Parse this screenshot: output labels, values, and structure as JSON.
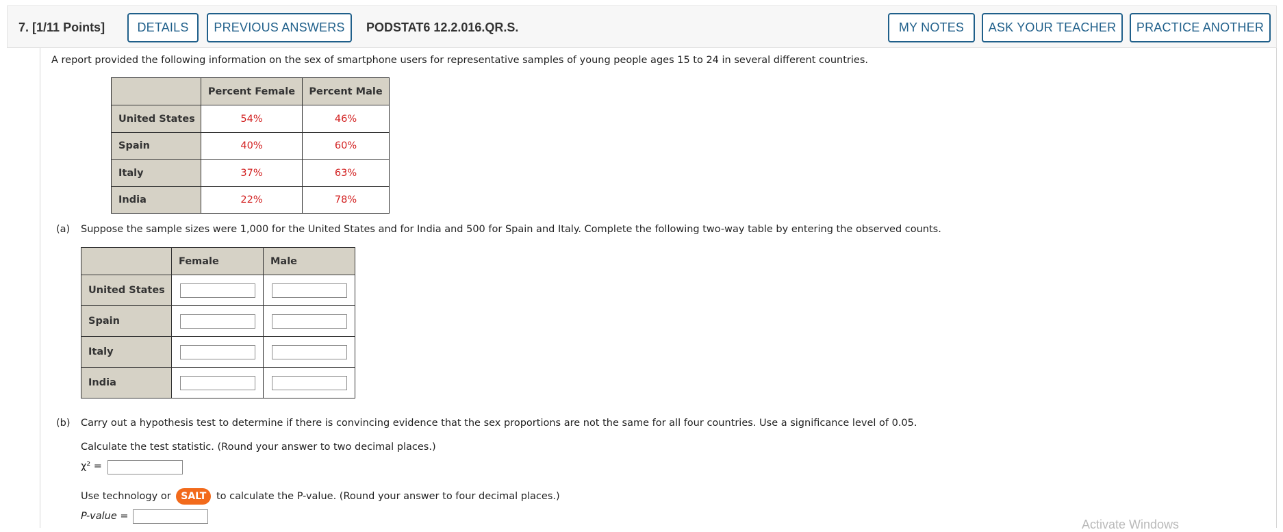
{
  "header": {
    "question_number": "7.",
    "points": "[1/11 Points]",
    "details_label": "DETAILS",
    "previous_answers_label": "PREVIOUS ANSWERS",
    "question_ref": "PODSTAT6 12.2.016.QR.S.",
    "my_notes_label": "MY NOTES",
    "ask_teacher_label": "ASK YOUR TEACHER",
    "practice_another_label": "PRACTICE ANOTHER"
  },
  "intro": "A report provided the following information on the sex of smartphone users for representative samples of young people ages 15 to 24 in several different countries.",
  "percent_table": {
    "col_female": "Percent Female",
    "col_male": "Percent Male",
    "rows": [
      {
        "country": "United States",
        "female": "54%",
        "male": "46%"
      },
      {
        "country": "Spain",
        "female": "40%",
        "male": "60%"
      },
      {
        "country": "Italy",
        "female": "37%",
        "male": "63%"
      },
      {
        "country": "India",
        "female": "22%",
        "male": "78%"
      }
    ]
  },
  "part_a": {
    "label": "(a)",
    "text": "Suppose the sample sizes were 1,000 for the United States and for India and 500 for Spain and Italy. Complete the following two-way table by entering the observed counts.",
    "col_female": "Female",
    "col_male": "Male",
    "rows": [
      "United States",
      "Spain",
      "Italy",
      "India"
    ]
  },
  "part_b": {
    "label": "(b)",
    "text": "Carry out a hypothesis test to determine if there is convincing evidence that the sex proportions are not the same for all four countries. Use a significance level of 0.05.",
    "calc_text": "Calculate the test statistic. (Round your answer to two decimal places.)",
    "chi_label": "χ² =",
    "use_text_before": "Use technology or",
    "salt_label": "SALT",
    "use_text_after": "to calculate the P-value. (Round your answer to four decimal places.)",
    "pvalue_label": "P-value ="
  },
  "watermark": "Activate Windows",
  "colors": {
    "accent": "#1f5f8a",
    "header_cell": "#d6d2c6",
    "value_red": "#d21f1f",
    "salt_orange": "#f26a1b"
  }
}
